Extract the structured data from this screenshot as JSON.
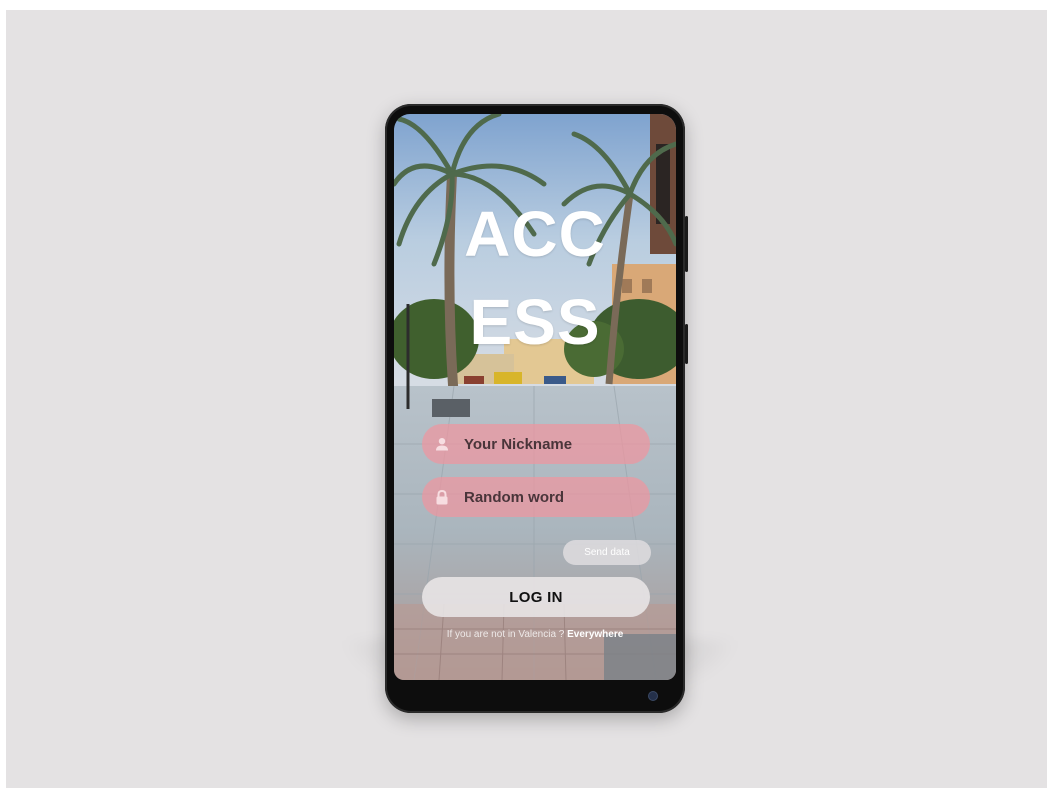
{
  "screen": {
    "title_line1": "ACC",
    "title_line2": "ESS",
    "nickname_placeholder": "Your Nickname",
    "password_placeholder": "Random word",
    "send_label": "Send data",
    "login_label": "LOG IN",
    "footer_text": "If you are not in Valencia ?",
    "footer_link": "Everywhere"
  },
  "icons": {
    "nickname": "user-icon",
    "password": "lock-icon"
  },
  "colors": {
    "field_bg": "#ee96a0",
    "button_bg": "#e8e4e6",
    "backdrop": "#e4e2e3"
  }
}
